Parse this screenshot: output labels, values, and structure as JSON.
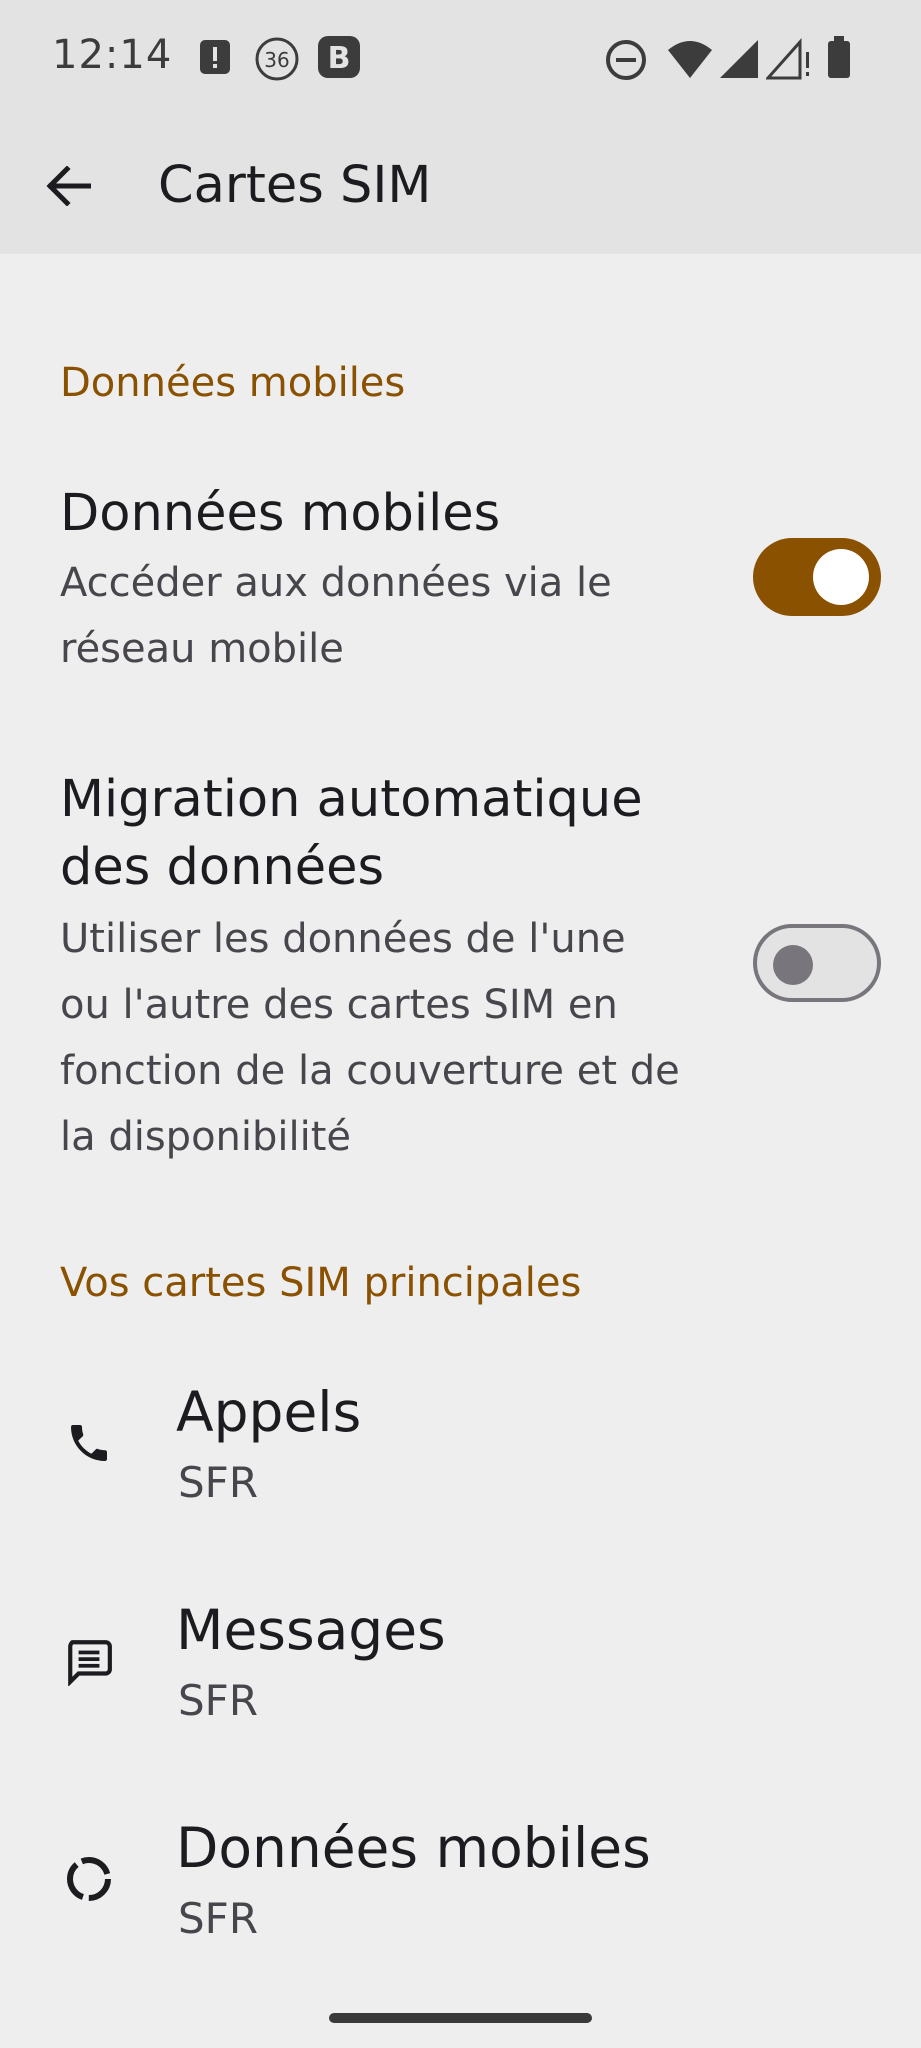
{
  "status_bar": {
    "time": "12:14",
    "notification_icons": [
      "alert-notification-icon",
      "badge-36-icon",
      "b-app-icon"
    ],
    "system_icons": [
      "do-not-disturb-icon",
      "wifi-icon",
      "signal-icon",
      "signal-no-data-icon",
      "battery-icon"
    ],
    "badge_number": "36",
    "b_letter": "B"
  },
  "app_bar": {
    "title": "Cartes SIM",
    "back_icon": "arrow-back-icon"
  },
  "section_mobile_data": {
    "header": "Données mobiles",
    "mobile_data": {
      "title": "Données mobiles",
      "summary": "Accéder aux données via le réseau mobile",
      "enabled": true
    },
    "auto_switch": {
      "title": "Migration automatique des données",
      "summary": "Utiliser les données de l'une ou l'autre des cartes SIM en fonction de la couverture et de la disponibilité",
      "enabled": false
    }
  },
  "section_primary_sims": {
    "header": "Vos cartes SIM principales",
    "items": [
      {
        "title": "Appels",
        "summary": "SFR",
        "icon": "phone-icon"
      },
      {
        "title": "Messages",
        "summary": "SFR",
        "icon": "message-icon"
      },
      {
        "title": "Données mobiles",
        "summary": "SFR",
        "icon": "data-usage-icon"
      }
    ]
  },
  "colors": {
    "accent": "#8a5100",
    "background": "#eeeeee",
    "app_bar": "#e3e3e3"
  }
}
